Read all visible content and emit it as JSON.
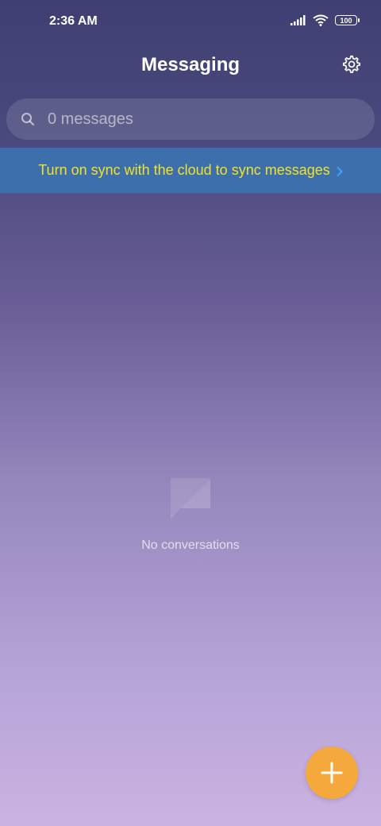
{
  "status_bar": {
    "time": "2:36 AM",
    "battery": "100",
    "icons": [
      "signal-icon",
      "wifi-icon",
      "battery-icon"
    ]
  },
  "header": {
    "title": "Messaging",
    "settings_icon": "gear-icon"
  },
  "search": {
    "placeholder": "0 messages",
    "icon": "search-icon"
  },
  "sync_banner": {
    "text": "Turn on sync with the cloud to sync messages",
    "text_color": "#f2e227",
    "background": "#3e6fad",
    "icon": "chevron-right-icon"
  },
  "empty_state": {
    "icon": "chat-bubble-icon",
    "text": "No conversations"
  },
  "fab": {
    "icon": "plus-icon",
    "color": "#f5a93c"
  }
}
